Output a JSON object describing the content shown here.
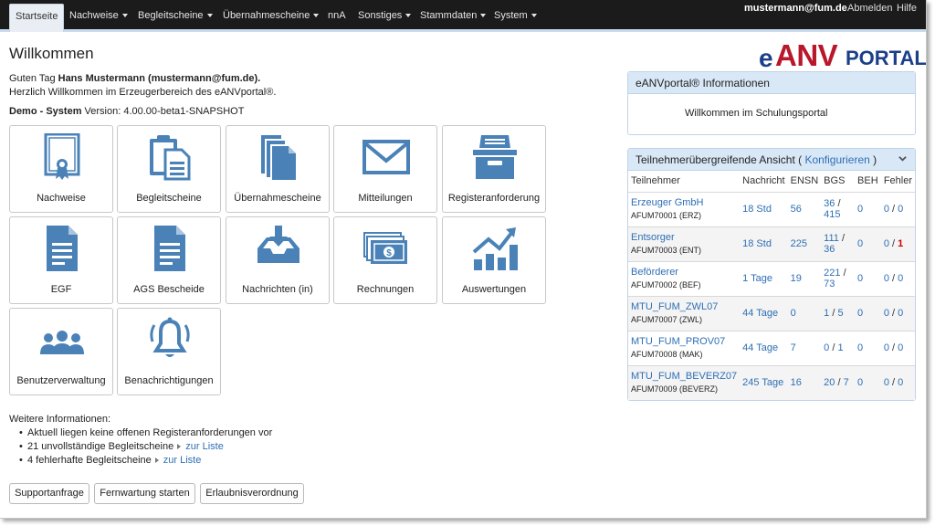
{
  "nav": {
    "items": [
      {
        "label": "Startseite",
        "caret": false
      },
      {
        "label": "Nachweise",
        "caret": true
      },
      {
        "label": "Begleitscheine",
        "caret": true
      },
      {
        "label": "Übernahmescheine",
        "caret": true
      },
      {
        "label": "nnA",
        "caret": false
      },
      {
        "label": "Sonstiges",
        "caret": true
      },
      {
        "label": "Stammdaten",
        "caret": true
      },
      {
        "label": "System",
        "caret": true
      }
    ],
    "user": "mustermann@fum.de",
    "logout": "Abmelden",
    "help": "Hilfe"
  },
  "page": {
    "title": "Willkommen",
    "greeting_prefix": "Guten Tag ",
    "greeting_name": "Hans Mustermann (mustermann@fum.de).",
    "welcome_line": "Herzlich Willkommen im Erzeugerbereich des eANVportal®.",
    "system_label": "Demo - System",
    "version_text": " Version: 4.00.00-beta1-SNAPSHOT"
  },
  "logo": {
    "e": "e",
    "anv": "ANV",
    "portal": "PORTAL"
  },
  "tiles": [
    {
      "label": "Nachweise",
      "icon": "certificate-icon"
    },
    {
      "label": "Begleitscheine",
      "icon": "clipboard-icon"
    },
    {
      "label": "Übernahmescheine",
      "icon": "documents-stack-icon"
    },
    {
      "label": "Mitteilungen",
      "icon": "envelope-icon"
    },
    {
      "label": "Registeranforderung",
      "icon": "archive-box-icon"
    },
    {
      "label": "EGF",
      "icon": "document-icon"
    },
    {
      "label": "AGS Bescheide",
      "icon": "document-icon"
    },
    {
      "label": "Nachrichten (in)",
      "icon": "inbox-icon"
    },
    {
      "label": "Rechnungen",
      "icon": "money-icon"
    },
    {
      "label": "Auswertungen",
      "icon": "chart-icon"
    },
    {
      "label": "Benutzerverwaltung",
      "icon": "users-icon"
    },
    {
      "label": "Benachrichtigungen",
      "icon": "bell-icon"
    }
  ],
  "info": {
    "title": "Weitere Informationen:",
    "items": [
      {
        "text": "Aktuell liegen keine offenen Registeranforderungen vor",
        "link": ""
      },
      {
        "text": "21 unvollständige Begleitscheine",
        "link": "zur Liste"
      },
      {
        "text": "4 fehlerhafte Begleitscheine",
        "link": "zur Liste"
      }
    ]
  },
  "buttons": [
    "Supportanfrage",
    "Fernwartung starten",
    "Erlaubnisverordnung"
  ],
  "info_panel": {
    "title": "eANVportal® Informationen",
    "body": "Willkommen im Schulungsportal"
  },
  "tn_panel": {
    "title_prefix": "Teilnehmerübergreifende Ansicht ( ",
    "configure": "Konfigurieren",
    "title_suffix": " )",
    "columns": [
      "Teilnehmer",
      "Nachricht",
      "ENSN",
      "BGS",
      "BEH",
      "Fehler"
    ],
    "rows": [
      {
        "name": "Erzeuger GmbH",
        "id": "AFUM70001 (ERZ)",
        "nachricht": "18 Std",
        "ensn": "56",
        "bgs_a": "36",
        "bgs_b": "415",
        "beh": "0",
        "fehler_a": "0",
        "fehler_b": "0",
        "fehler_b_alert": false
      },
      {
        "name": "Entsorger",
        "id": "AFUM70003 (ENT)",
        "nachricht": "18 Std",
        "ensn": "225",
        "bgs_a": "111",
        "bgs_b": "36",
        "beh": "0",
        "fehler_a": "0",
        "fehler_b": "1",
        "fehler_b_alert": true
      },
      {
        "name": "Beförderer",
        "id": "AFUM70002 (BEF)",
        "nachricht": "1 Tage",
        "ensn": "19",
        "bgs_a": "221",
        "bgs_b": "73",
        "beh": "0",
        "fehler_a": "0",
        "fehler_b": "0",
        "fehler_b_alert": false
      },
      {
        "name": "MTU_FUM_ZWL07",
        "id": "AFUM70007 (ZWL)",
        "nachricht": "44 Tage",
        "ensn": "0",
        "bgs_a": "1",
        "bgs_b": "5",
        "beh": "0",
        "fehler_a": "0",
        "fehler_b": "0",
        "fehler_b_alert": false
      },
      {
        "name": "MTU_FUM_PROV07",
        "id": "AFUM70008 (MAK)",
        "nachricht": "44 Tage",
        "ensn": "7",
        "bgs_a": "0",
        "bgs_b": "1",
        "beh": "0",
        "fehler_a": "0",
        "fehler_b": "0",
        "fehler_b_alert": false
      },
      {
        "name": "MTU_FUM_BEVERZ07",
        "id": "AFUM70009 (BEVERZ)",
        "nachricht": "245 Tage",
        "ensn": "16",
        "bgs_a": "20",
        "bgs_b": "7",
        "beh": "0",
        "fehler_a": "0",
        "fehler_b": "0",
        "fehler_b_alert": false
      }
    ]
  },
  "colors": {
    "accent": "#2e6fb5",
    "icon": "#4a82b8",
    "alert": "#d00000",
    "navbar": "#1b1b1b",
    "panel_head": "#d9e8f7"
  }
}
